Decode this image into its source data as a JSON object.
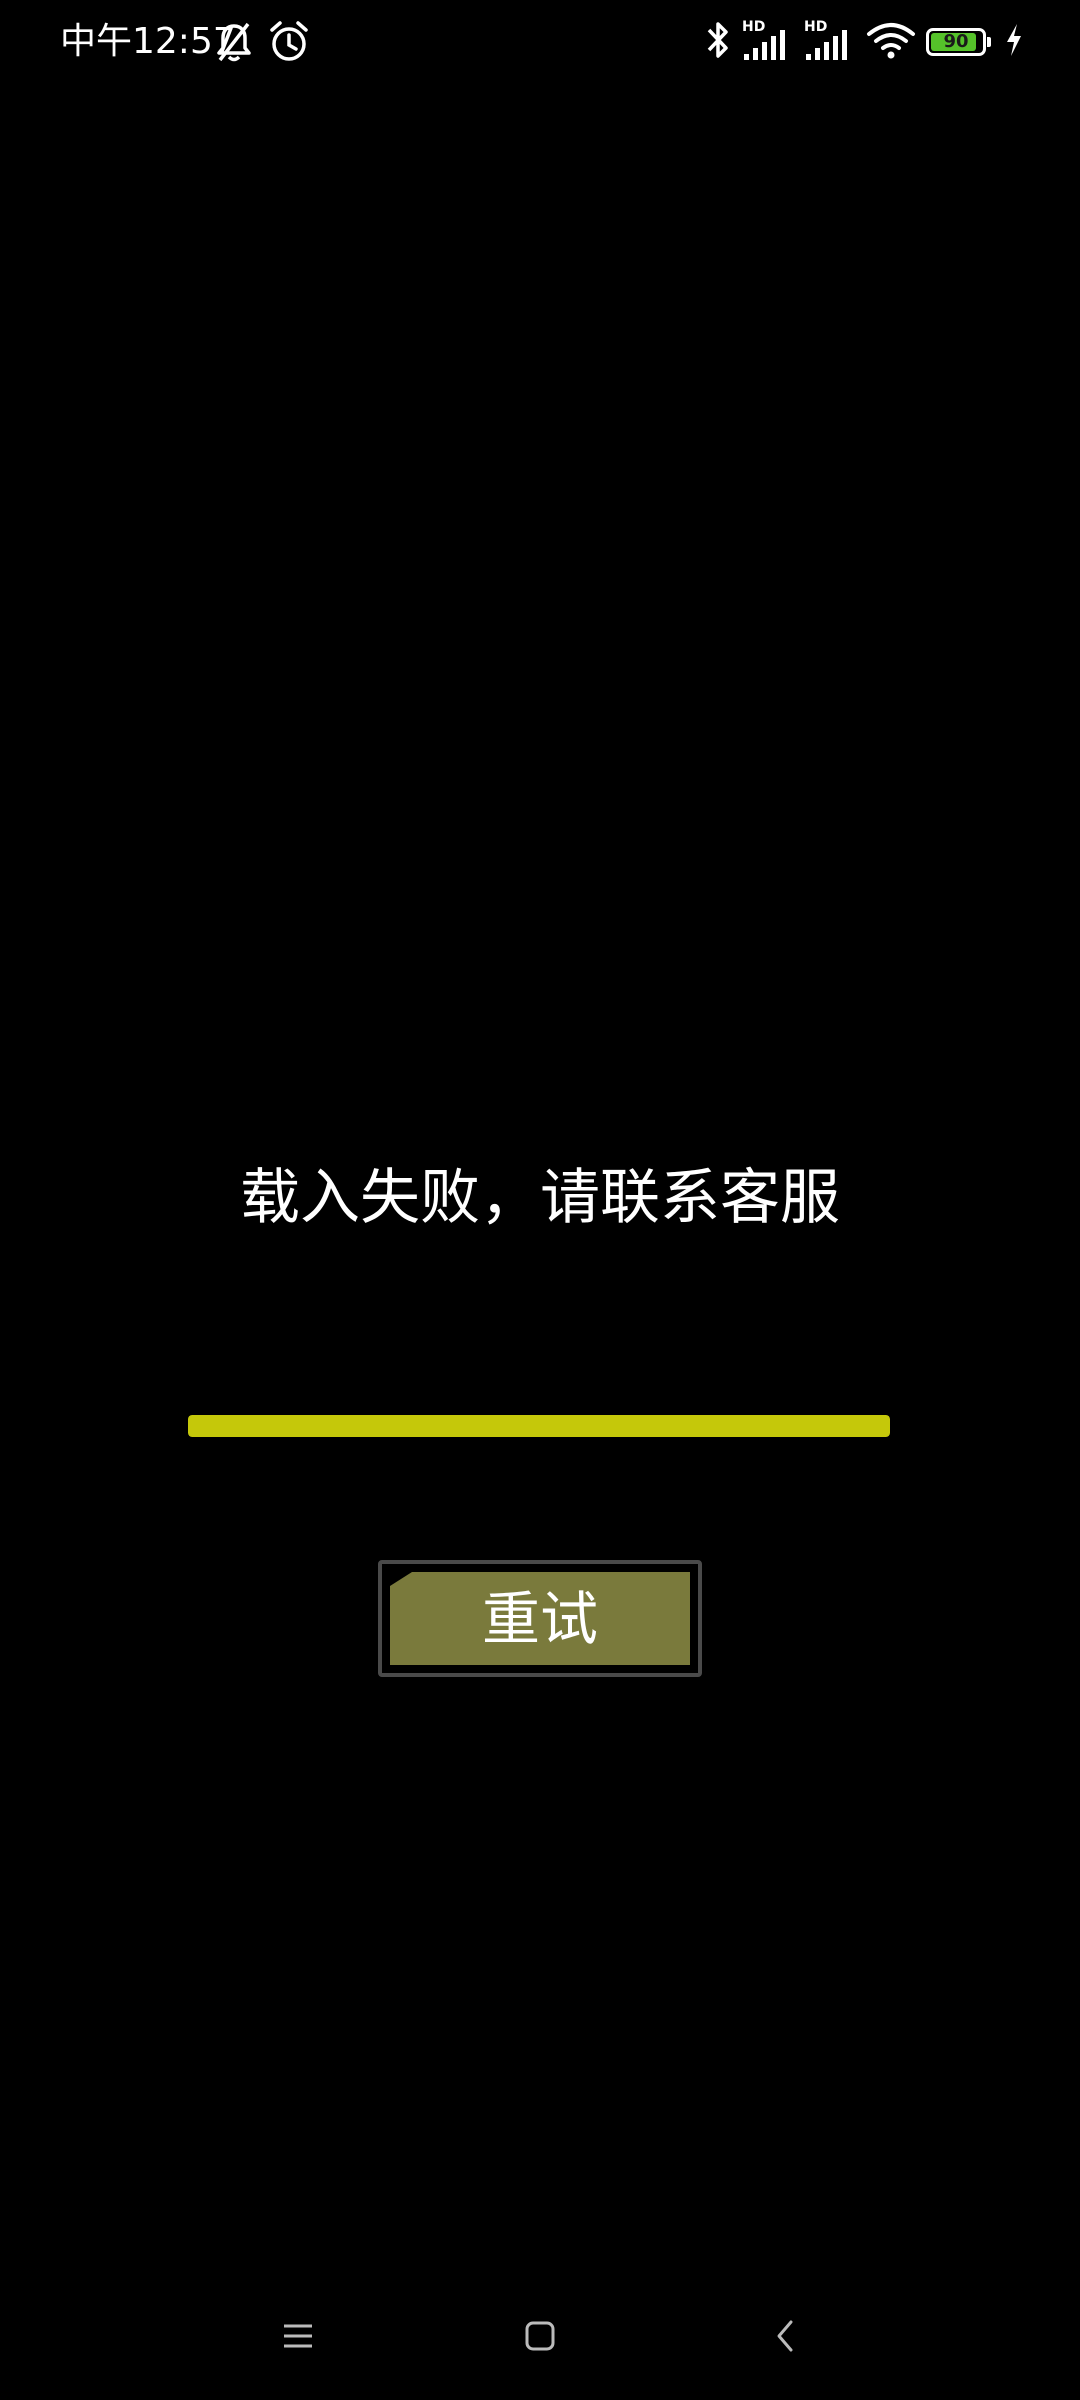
{
  "status_bar": {
    "time": "中午12:57",
    "battery_level": "90",
    "battery_fraction": 0.9,
    "battery_color": "#55c22a",
    "signal_1_label": "HD",
    "signal_2_label": "HD",
    "icons": [
      "bell-off-icon",
      "alarm-icon",
      "bluetooth-icon",
      "signal-icon",
      "wifi-icon",
      "battery-icon",
      "charging-icon"
    ]
  },
  "main": {
    "error_message": "载入失败，请联系客服",
    "progress_fraction": 1.0,
    "progress_color": "#c5c80a",
    "retry_label": "重试",
    "retry_color": "#7a7a3c"
  },
  "nav_bar": {
    "icons": [
      "menu-icon",
      "home-icon",
      "back-icon"
    ]
  }
}
